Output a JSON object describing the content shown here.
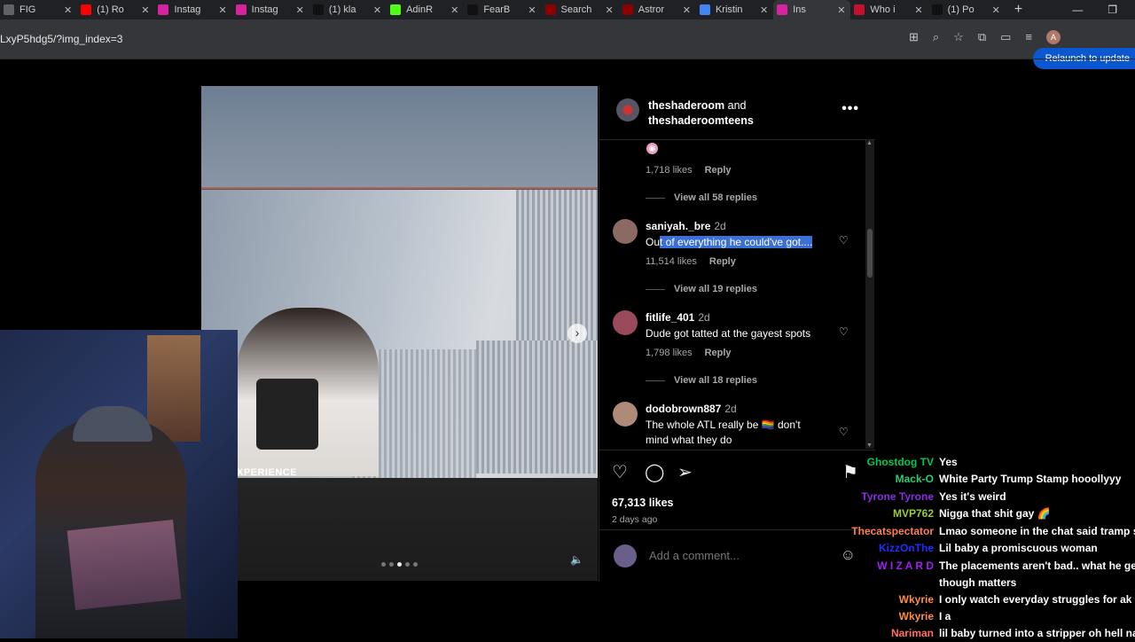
{
  "browser": {
    "tabs": [
      {
        "title": "FIG",
        "color": "#5f6368"
      },
      {
        "title": "(1) Ro",
        "color": "#ff0000"
      },
      {
        "title": "Instag",
        "color": "#d6249f"
      },
      {
        "title": "Instag",
        "color": "#d6249f"
      },
      {
        "title": "(1) kla",
        "color": "#111111"
      },
      {
        "title": "AdinR",
        "color": "#53fc18"
      },
      {
        "title": "FearB",
        "color": "#111111"
      },
      {
        "title": "Search",
        "color": "#8b0000"
      },
      {
        "title": "Astror",
        "color": "#8b0000"
      },
      {
        "title": "Kristin",
        "color": "#4285f4"
      },
      {
        "title": "Ins",
        "color": "#d6249f"
      },
      {
        "title": "Who i",
        "color": "#c8102e"
      },
      {
        "title": "(1) Po",
        "color": "#111111"
      }
    ],
    "new_tab": "+",
    "url": "LxyP5hdg5/?img_index=3",
    "profile_initial": "A",
    "relaunch_label": "Relaunch to update"
  },
  "post": {
    "header": {
      "user1": "theshaderoom",
      "and": "and",
      "user2": "theshaderoomteens",
      "more": "•••"
    },
    "media": {
      "overlay_text": "XPERIENCE",
      "next": "›",
      "volume": "🔈"
    },
    "comments": [
      {
        "likes": "1,718 likes",
        "reply": "Reply",
        "view": "View all 58 replies"
      },
      {
        "user": "saniyah._bre",
        "age": "2d",
        "text_plain": "Ou",
        "text_highlight": "t of everything he could've got....",
        "likes": "11,514 likes",
        "reply": "Reply",
        "view": "View all 19 replies",
        "avatar": "#8a6a62"
      },
      {
        "user": "fitlife_401",
        "age": "2d",
        "text": "Dude got tatted at the gayest spots",
        "likes": "1,798 likes",
        "reply": "Reply",
        "view": "View all 18 replies",
        "avatar": "#9a4a5a"
      },
      {
        "user": "dodobrown887",
        "age": "2d",
        "text": "The whole ATL really be 🏳️‍🌈 don't mind what they do",
        "avatar": "#b08a78"
      }
    ],
    "likes": "67,313 likes",
    "ago": "2 days ago",
    "add_comment_placeholder": "Add a comment..."
  },
  "chat": [
    {
      "user": "Ghostdog TV",
      "color": "#00c853",
      "message": "Yes"
    },
    {
      "user": "Mack-O",
      "color": "#2ecc71",
      "message": "White Party Trump Stamp hooollyyy"
    },
    {
      "user": "Tyrone Tyrone",
      "color": "#8a2be2",
      "message": "Yes it's weird"
    },
    {
      "user": "MVP762",
      "color": "#9acd32",
      "message": "Nigga that shit gay 🌈"
    },
    {
      "user": "Thecatspectator",
      "color": "#ff7f50",
      "message": "Lmao someone in the chat said tramp sta"
    },
    {
      "user": "KizzOnThe",
      "color": "#1e2fff",
      "message": "Lil baby a promiscuous woman"
    },
    {
      "user": "W I Z A R D",
      "color": "#a020f0",
      "message": "The placements aren't bad.. what he gets",
      "message2": "though matters"
    },
    {
      "user": "Wkyrie",
      "color": "#ff8c42",
      "message": "I only watch everyday struggles for ak an"
    },
    {
      "user": "Wkyrie",
      "color": "#ff8c42",
      "message": "I a"
    },
    {
      "user": "Nariman",
      "color": "#ff6f61",
      "message": "lil baby turned into a stripper oh hell naw"
    }
  ]
}
